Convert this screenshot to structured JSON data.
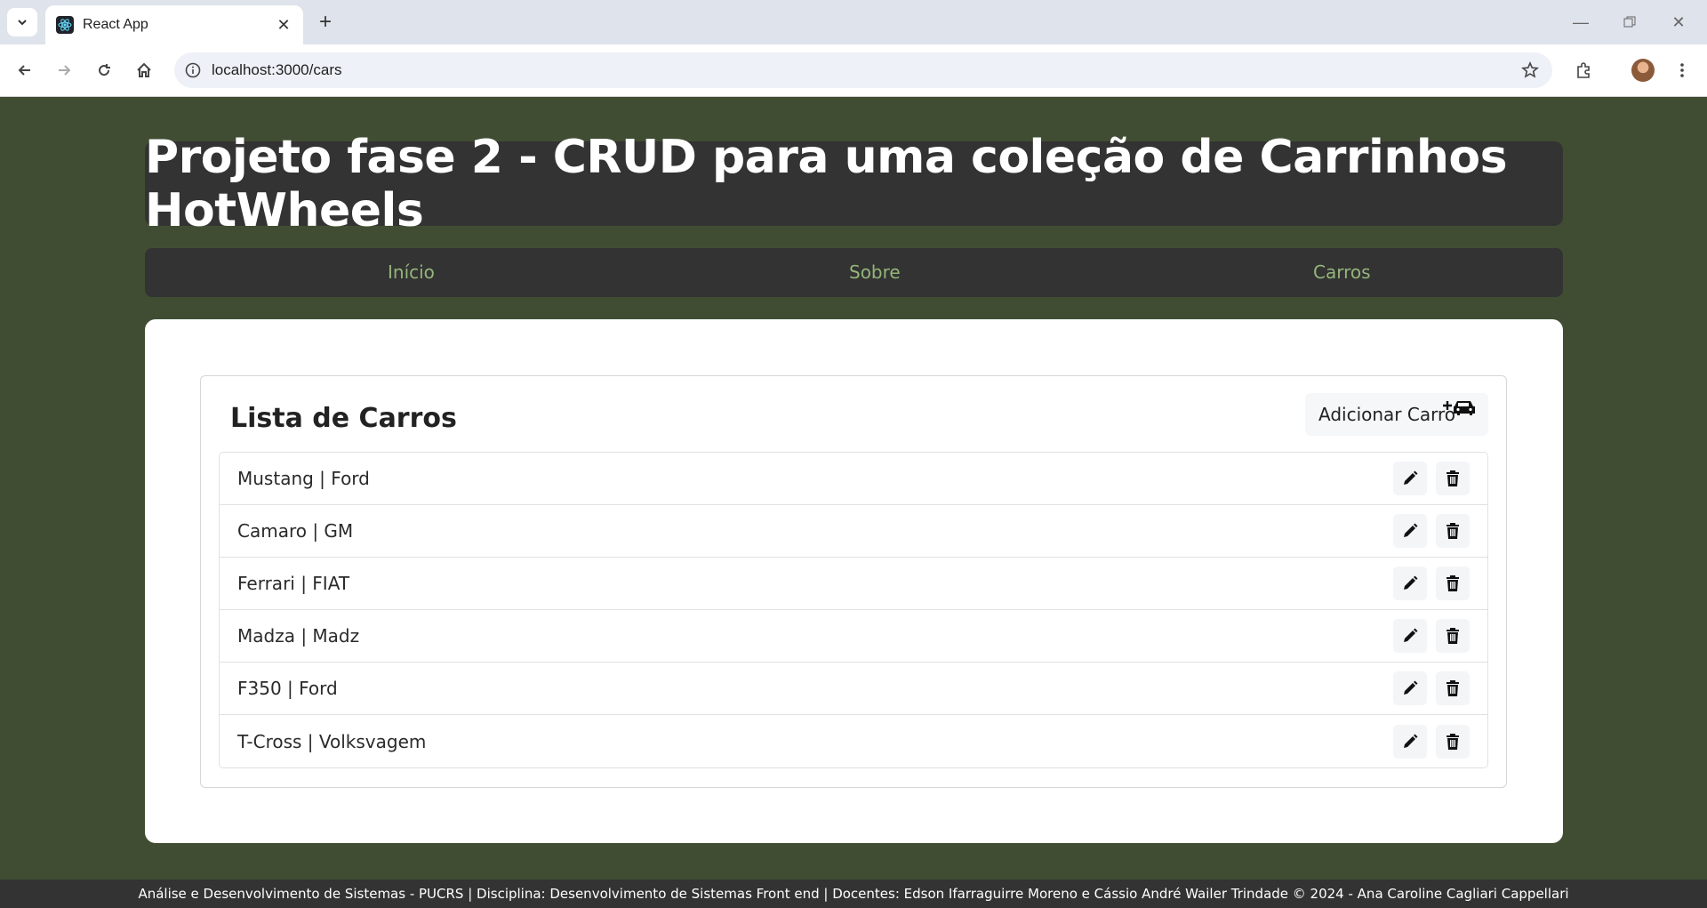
{
  "browser": {
    "tab_title": "React App",
    "url": "localhost:3000/cars"
  },
  "header": {
    "title": "Projeto fase 2 - CRUD para uma coleção de Carrinhos HotWheels"
  },
  "nav": {
    "items": [
      {
        "label": "Início"
      },
      {
        "label": "Sobre"
      },
      {
        "label": "Carros"
      }
    ],
    "link_color": "#95b57a"
  },
  "car_list": {
    "title": "Lista de Carros",
    "add_button_label": "Adicionar Carro",
    "items": [
      {
        "label": "Mustang | Ford"
      },
      {
        "label": "Camaro | GM"
      },
      {
        "label": "Ferrari | FIAT"
      },
      {
        "label": "Madza | Madz"
      },
      {
        "label": "F350 | Ford"
      },
      {
        "label": "T-Cross | Volksvagem"
      }
    ]
  },
  "footer": {
    "text": "Análise e Desenvolvimento de Sistemas - PUCRS | Disciplina: Desenvolvimento de Sistemas Front end | Docentes: Edson Ifarraguirre Moreno e Cássio André Wailer Trindade © 2024 - Ana Caroline Cagliari Cappellari"
  },
  "colors": {
    "page_background": "#404d33",
    "header_background": "#333333",
    "card_background": "#ffffff"
  }
}
